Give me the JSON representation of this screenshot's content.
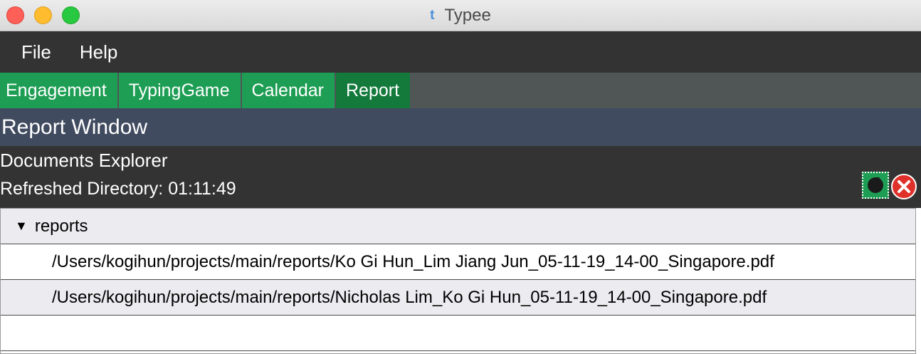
{
  "window": {
    "title": "Typee",
    "app_icon_glyph": "t"
  },
  "menu": {
    "items": [
      {
        "label": "File"
      },
      {
        "label": "Help"
      }
    ]
  },
  "tabs": [
    {
      "label": "Engagement",
      "active": false
    },
    {
      "label": "TypingGame",
      "active": false
    },
    {
      "label": "Calendar",
      "active": false
    },
    {
      "label": "Report",
      "active": true
    }
  ],
  "report_window": {
    "header": "Report Window"
  },
  "explorer": {
    "title": "Documents Explorer",
    "refreshed_text": "Refreshed Directory: 01:11:49",
    "refresh_icon": "refresh-icon",
    "delete_icon": "close-circle-icon"
  },
  "tree": {
    "root_label": "reports",
    "root_expanded": true,
    "files": [
      {
        "path": "/Users/kogihun/projects/main/reports/Ko Gi Hun_Lim Jiang Jun_05-11-19_14-00_Singapore.pdf"
      },
      {
        "path": "/Users/kogihun/projects/main/reports/Nicholas Lim_Ko Gi Hun_05-11-19_14-00_Singapore.pdf"
      }
    ]
  },
  "colors": {
    "tab_green": "#1e9e54",
    "tab_active": "#147a3c",
    "menubar": "#333333",
    "header_blue": "#414b60",
    "delete_red": "#e0302a"
  }
}
